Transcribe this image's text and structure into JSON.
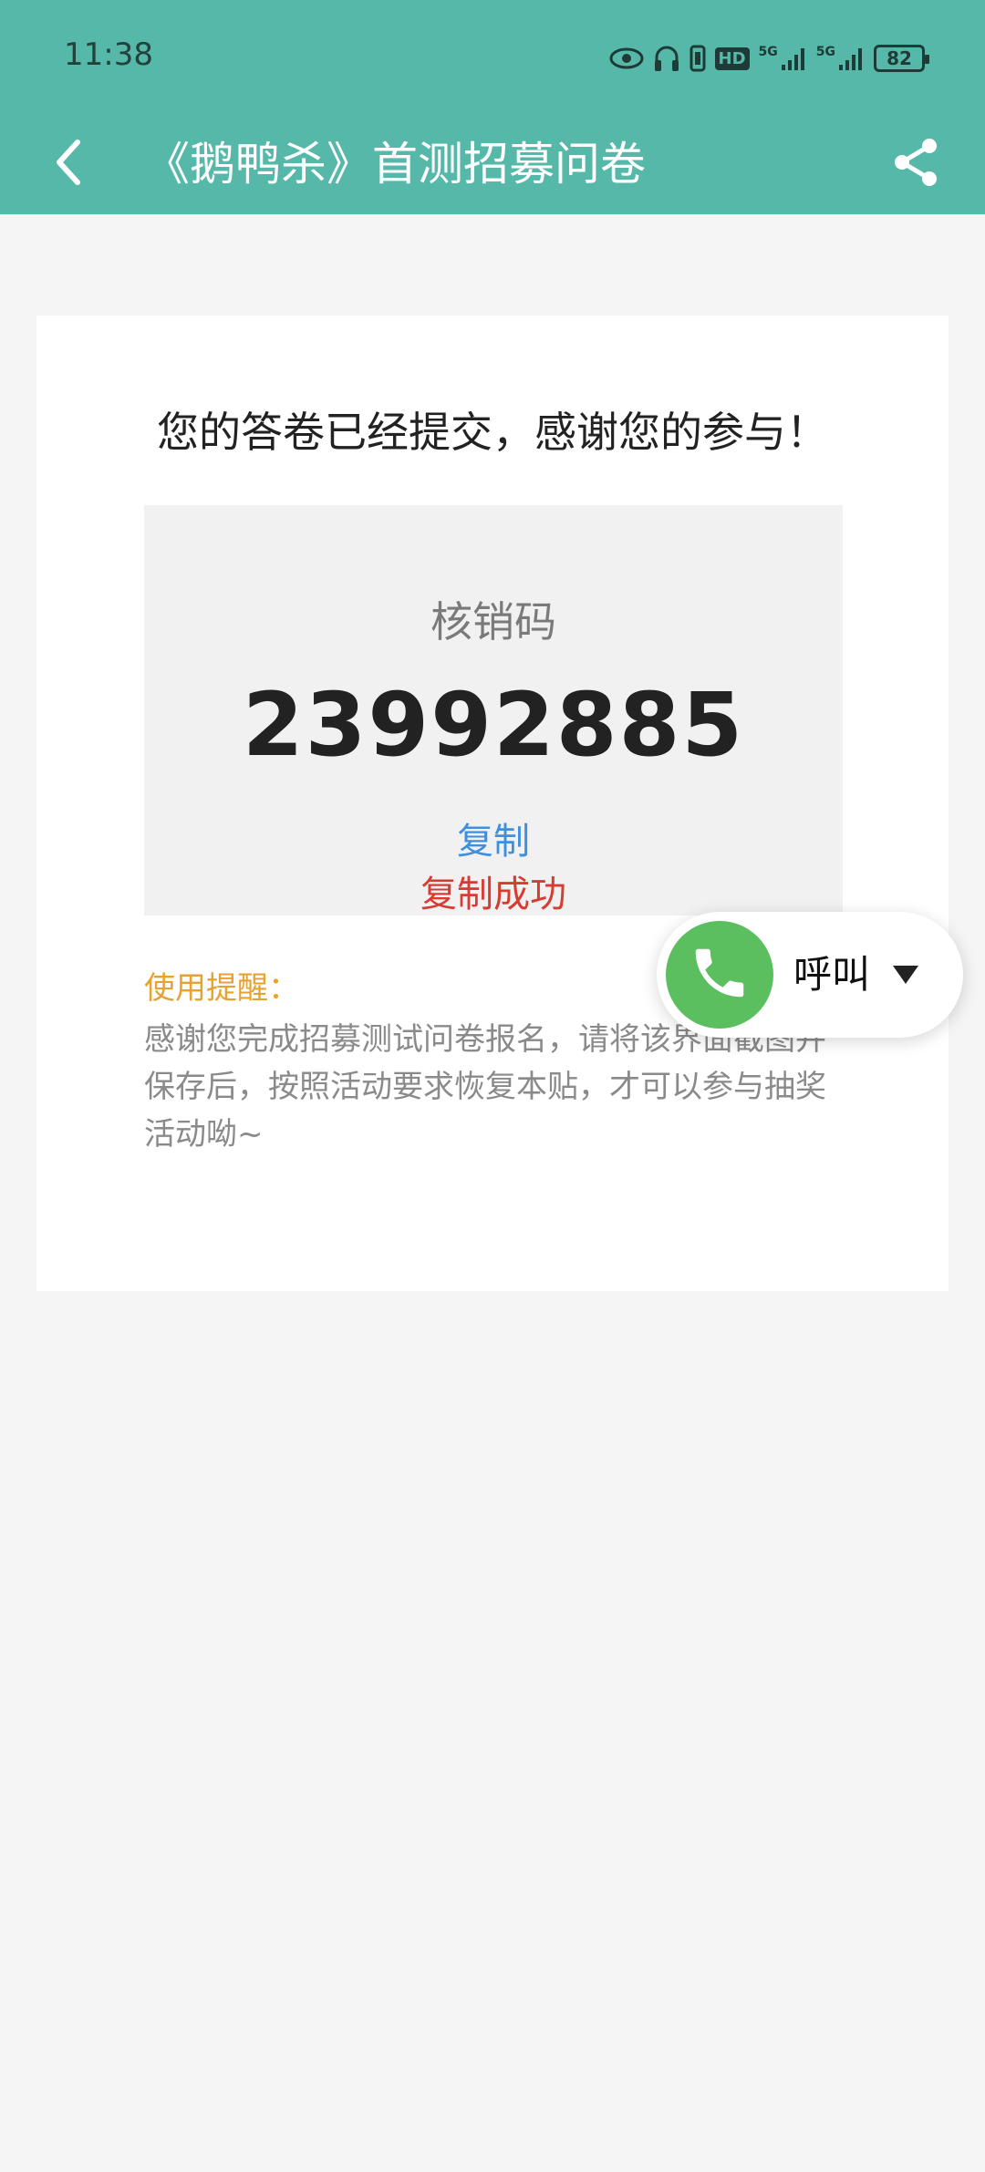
{
  "status_bar": {
    "time": "11:38",
    "hd_label": "HD",
    "signal_1": "5G",
    "signal_2": "5G",
    "battery": "82"
  },
  "nav": {
    "title": "《鹅鸭杀》首测招募问卷",
    "back_icon": "chevron-left-icon",
    "share_icon": "share-icon"
  },
  "card": {
    "success_message": "您的答卷已经提交，感谢您的参与！",
    "code_label": "核销码",
    "code_value": "23992885",
    "copy_label": "复制",
    "copy_success_label": "复制成功",
    "tip_title": "使用提醒：",
    "tip_body": "感谢您完成招募测试问卷报名，请将该界面截图并保存后，按照活动要求恢复本贴，才可以参与抽奖活动呦~"
  },
  "call_fab": {
    "label": "呼叫",
    "icon": "phone-icon"
  },
  "colors": {
    "header_bg": "#56b8a9",
    "copy_link": "#3d8fe0",
    "copy_success": "#d73c32",
    "tip_title": "#e7a232",
    "call_green": "#5cbf5f"
  }
}
